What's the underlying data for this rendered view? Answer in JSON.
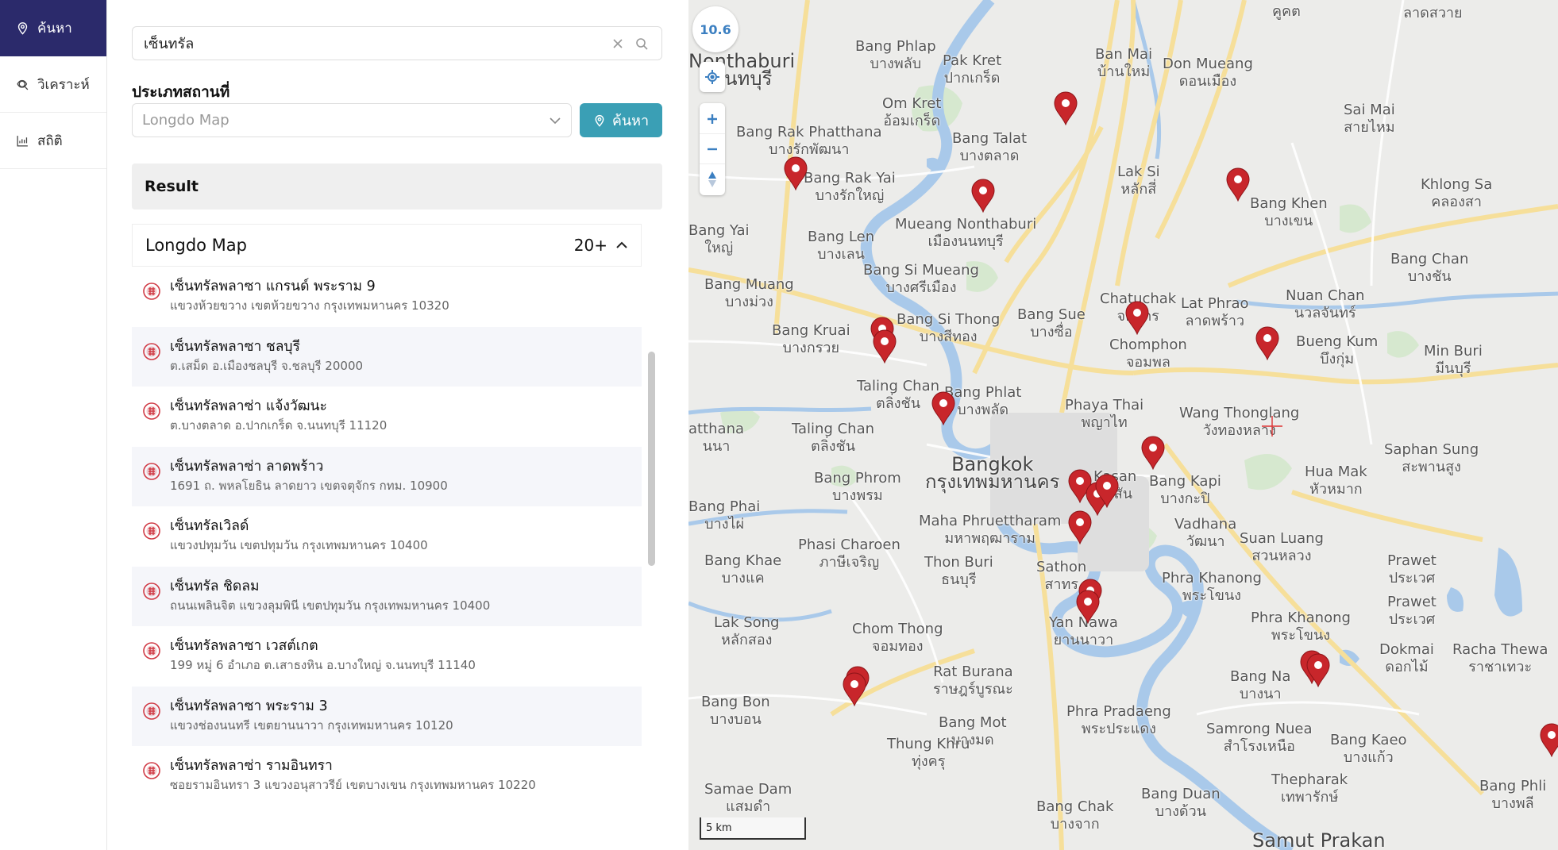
{
  "nav": {
    "items": [
      {
        "label": "ค้นหา",
        "icon": "map-pin-icon",
        "active": true
      },
      {
        "label": "วิเคราะห์",
        "icon": "analyze-icon",
        "active": false
      },
      {
        "label": "สถิติ",
        "icon": "chart-icon",
        "active": false
      }
    ]
  },
  "search": {
    "value": "เซ็นทรัล",
    "placeholder": ""
  },
  "place_type": {
    "label": "ประเภทสถานที่",
    "selected": "Longdo Map"
  },
  "search_button": "ค้นหา",
  "result": {
    "header": "Result",
    "group": {
      "title": "Longdo Map",
      "count": "20+"
    },
    "items": [
      {
        "name": "เซ็นทรัลพลาซา แกรนด์ พระราม 9",
        "address": "แขวงห้วยขวาง เขตห้วยขวาง กรุงเทพมหานคร 10320"
      },
      {
        "name": "เซ็นทรัลพลาซา ชลบุรี",
        "address": "ต.เสม็ด อ.เมืองชลบุรี จ.ชลบุรี 20000"
      },
      {
        "name": "เซ็นทรัลพลาซ่า แจ้งวัฒนะ",
        "address": "ต.บางตลาด อ.ปากเกร็ด จ.นนทบุรี 11120"
      },
      {
        "name": "เซ็นทรัลพลาซ่า ลาดพร้าว",
        "address": "1691 ถ. พหลโยธิน ลาดยาว เขตจตุจักร กทม. 10900"
      },
      {
        "name": "เซ็นทรัลเวิลด์",
        "address": "แขวงปทุมวัน เขตปทุมวัน กรุงเทพมหานคร 10400"
      },
      {
        "name": "เซ็นทรัล ชิดลม",
        "address": "ถนนเพลินจิต แขวงลุมพินี เขตปทุมวัน กรุงเทพมหานคร 10400"
      },
      {
        "name": "เซ็นทรัลพลาซา เวสต์เกต",
        "address": "199 หมู่ 6 อำเภอ ต.เสาธงหิน อ.บางใหญ่ จ.นนทบุรี 11140"
      },
      {
        "name": "เซ็นทรัลพลาซา พระราม 3",
        "address": "แขวงช่องนนทรี เขตยานนาวา กรุงเทพมหานคร 10120"
      },
      {
        "name": "เซ็นทรัลพลาซ่า รามอินทรา",
        "address": "ซอยรามอินทรา 3 แขวงอนุสาวรีย์ เขตบางเขน กรุงเทพมหานคร 10220"
      }
    ]
  },
  "map": {
    "zoom_level": "10.6",
    "scale_label": "5 km",
    "places": [
      {
        "text": "Bang Phlap\nบางพลับ"
      },
      {
        "text": "Pak Kret\nปากเกร็ด"
      },
      {
        "text": "Ban Mai\nบ้านใหม่"
      },
      {
        "text": "Don Mueang\nดอนเมือง"
      },
      {
        "text": "Nonthaburi\nนนทบุรี"
      },
      {
        "text": "Om Kret\nอ้อมเกร็ด"
      },
      {
        "text": "Sai Mai\nสายไหม"
      },
      {
        "text": "Bang Rak Phatthana\nบางรักพัฒนา"
      },
      {
        "text": "Bang Talat\nบางตลาด"
      },
      {
        "text": "Bang Rak Yai\nบางรักใหญ่"
      },
      {
        "text": "Lak Si\nหลักสี่"
      },
      {
        "text": "Bang Khen\nบางเขน"
      },
      {
        "text": "Khlong Sa\nคลองสา"
      },
      {
        "text": "Mueang Nonthaburi\nเมืองนนทบุรี"
      },
      {
        "text": "Bang Len\nบางเลน"
      },
      {
        "text": "Bang Si Mueang\nบางศรีเมือง"
      },
      {
        "text": "Bang Muang\nบางม่วง"
      },
      {
        "text": "Bang Chan\nบางชัน"
      },
      {
        "text": "Chatuchak\nจตุจักร"
      },
      {
        "text": "Lat Phrao\nลาดพร้าว"
      },
      {
        "text": "Nuan Chan\nนวลจันทร์"
      },
      {
        "text": "Bang Sue\nบางซื่อ"
      },
      {
        "text": "Bang Si Thong\nบางสีทอง"
      },
      {
        "text": "Bang Kruai\nบางกรวย"
      },
      {
        "text": "Chomphon\nจอมพล"
      },
      {
        "text": "Bueng Kum\nบึงกุ่ม"
      },
      {
        "text": "Min Buri\nมีนบุรี"
      },
      {
        "text": "Taling Chan\nตลิ่งชัน"
      },
      {
        "text": "Bang Phlat\nบางพลัด"
      },
      {
        "text": "Phaya Thai\nพญาไท"
      },
      {
        "text": "Wang Thonglang\nวังทองหลาง"
      },
      {
        "text": "Taling Chan\nตลิ่งชัน"
      },
      {
        "text": "Bangkok\nกรุงเทพมหานคร"
      },
      {
        "text": "Saphan Sung\nสะพานสูง"
      },
      {
        "text": "Bang Phrom\nบางพรม"
      },
      {
        "text": "Kasan\nกะสัน"
      },
      {
        "text": "Bang Kapi\nบางกะปิ"
      },
      {
        "text": "Hua Mak\nหัวหมาก"
      },
      {
        "text": "Bang Phai\nบางไผ่"
      },
      {
        "text": "Maha Phruettharam\nมหาพฤฒาราม"
      },
      {
        "text": "Vadhana\nวัฒนา"
      },
      {
        "text": "Suan Luang\nสวนหลวง"
      },
      {
        "text": "Phasi Charoen\nภาษีเจริญ"
      },
      {
        "text": "Bang Khae\nบางแค"
      },
      {
        "text": "Thon Buri\nธนบุรี"
      },
      {
        "text": "Sathon\nสาทร"
      },
      {
        "text": "Phra Khanong\nพระโขนง"
      },
      {
        "text": "Prawet\nประเวศ"
      },
      {
        "text": "Lak Song\nหลักสอง"
      },
      {
        "text": "Chom Thong\nจอมทอง"
      },
      {
        "text": "Yan Nawa\nยานนาวา"
      },
      {
        "text": "Phra Khanong\nพระโขนง"
      },
      {
        "text": "Prawet\nประเวศ"
      },
      {
        "text": "Dokmai\nดอกไม้"
      },
      {
        "text": "Racha Thewa\nราชาเทวะ"
      },
      {
        "text": "Bang Na\nบางนา"
      },
      {
        "text": "Rat Burana\nราษฎร์บูรณะ"
      },
      {
        "text": "Bang Bon\nบางบอน"
      },
      {
        "text": "Bang Mot\nบางมด"
      },
      {
        "text": "Phra Pradaeng\nพระประแดง"
      },
      {
        "text": "Samrong Nuea\nสำโรงเหนือ"
      },
      {
        "text": "Bang Kaeo\nบางแก้ว"
      },
      {
        "text": "Thung Khru\nทุ่งครุ"
      },
      {
        "text": "Samae Dam\nแสมดำ"
      },
      {
        "text": "Bang Chak\nบางจาก"
      },
      {
        "text": "Bang Duan\nบางด้วน"
      },
      {
        "text": "Thepharak\nเทพารักษ์"
      },
      {
        "text": "Bang Phli\nบางพลี"
      },
      {
        "text": "Samut Prakan"
      },
      {
        "text": "Bang Yai\nใหญ่"
      },
      {
        "text": "atthana\nนนา"
      },
      {
        "text": "คูคต"
      },
      {
        "text": "ลาดสวาย"
      }
    ]
  },
  "colors": {
    "nav_active": "#2b2a6b",
    "search_button": "#3a9fb5",
    "marker": "#c8262b",
    "result_icon": "#d03a45"
  }
}
